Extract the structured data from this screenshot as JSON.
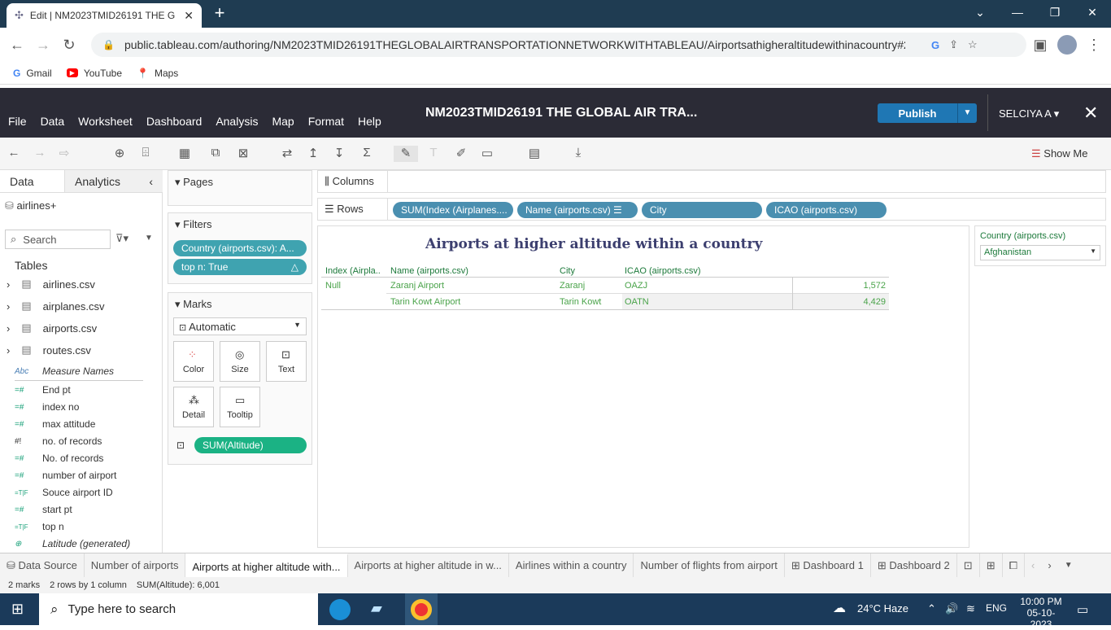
{
  "browser": {
    "tab_title": "Edit | NM2023TMID26191 THE G",
    "url": "public.tableau.com/authoring/NM2023TMID26191THEGLOBALAIRTRANSPORTATIONNETWORKWITHTABLEAU/Airportsathigheraltitudewithinacountry#2",
    "bookmarks": [
      "Gmail",
      "YouTube",
      "Maps"
    ]
  },
  "tableau": {
    "menus": [
      "File",
      "Data",
      "Worksheet",
      "Dashboard",
      "Analysis",
      "Map",
      "Format",
      "Help"
    ],
    "workbook_title": "NM2023TMID26191 THE GLOBAL AIR TRA...",
    "publish_label": "Publish",
    "user": "SELCIYA A",
    "show_me": "Show Me"
  },
  "datapane": {
    "tab_data": "Data",
    "tab_analytics": "Analytics",
    "source": "airlines+",
    "search_placeholder": "Search",
    "tables_heading": "Tables",
    "tables": [
      "airlines.csv",
      "airplanes.csv",
      "airports.csv",
      "routes.csv"
    ],
    "fields": [
      {
        "icon": "Abc",
        "name": "Measure Names"
      },
      {
        "icon": "=#",
        "name": "End pt"
      },
      {
        "icon": "=#",
        "name": "index no"
      },
      {
        "icon": "=#",
        "name": "max attitude"
      },
      {
        "icon": "#!",
        "name": "no. of records"
      },
      {
        "icon": "=#",
        "name": "No. of records"
      },
      {
        "icon": "=#",
        "name": "number of airport"
      },
      {
        "icon": "=T|F",
        "name": "Souce airport ID"
      },
      {
        "icon": "=#",
        "name": "start pt"
      },
      {
        "icon": "=T|F",
        "name": "top n"
      },
      {
        "icon": "globe",
        "name": "Latitude (generated)"
      }
    ]
  },
  "cards": {
    "pages_label": "Pages",
    "filters_label": "Filters",
    "filters": [
      "Country (airports.csv): A...",
      "top n: True"
    ],
    "marks_label": "Marks",
    "mark_type": "Automatic",
    "mark_buttons": [
      "Color",
      "Size",
      "Text",
      "Detail",
      "Tooltip"
    ],
    "marks_pill": "SUM(Altitude)"
  },
  "shelves": {
    "columns_label": "Columns",
    "rows_label": "Rows",
    "rows_pills": [
      "SUM(Index (Airplanes....",
      "Name (airports.csv)",
      "City",
      "ICAO (airports.csv)"
    ]
  },
  "view": {
    "title": "Airports at higher altitude within a country",
    "headers": [
      "Index (Airpla..",
      "Name (airports.csv)",
      "City",
      "ICAO (airports.csv)"
    ],
    "index_value": "Null",
    "rows": [
      {
        "name": "Zaranj Airport",
        "city": "Zaranj",
        "icao": "OAZJ",
        "altitude": "1,572"
      },
      {
        "name": "Tarin Kowt Airport",
        "city": "Tarin Kowt",
        "icao": "OATN",
        "altitude": "4,429"
      }
    ]
  },
  "country_filter": {
    "label": "Country (airports.csv)",
    "value": "Afghanistan"
  },
  "sheet_tabs": [
    "Data Source",
    "Number of airports",
    "Airports at higher altitude with...",
    "Airports at higher altitude in w...",
    "Airlines within a country",
    "Number of flights from airport",
    "Dashboard 1",
    "Dashboard 2"
  ],
  "status": {
    "marks": "2 marks",
    "rows_cols": "2 rows by 1 column",
    "sum": "SUM(Altitude): 6,001"
  },
  "taskbar": {
    "search_placeholder": "Type here to search",
    "weather": "24°C  Haze",
    "lang": "ENG",
    "time": "10:00 PM",
    "date": "05-10-2023"
  }
}
